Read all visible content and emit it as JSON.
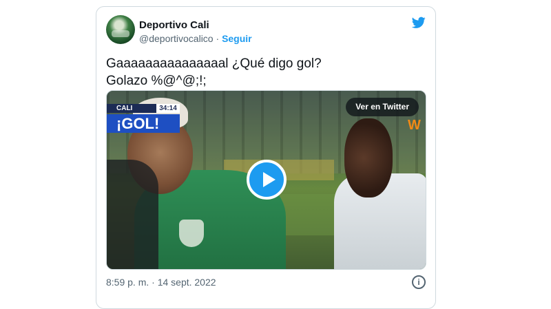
{
  "tweet": {
    "author_name": "Deportivo Cali",
    "handle": "@deportivocalico",
    "separator": " · ",
    "follow_label": "Seguir",
    "text": "Gaaaaaaaaaaaaaaal ¿Qué digo gol?\nGolazo %@^@;!;",
    "timestamp": "8:59 p. m. · 14 sept. 2022",
    "info_glyph": "i"
  },
  "media": {
    "scoreboard": {
      "team": "CALI",
      "time": "34:14",
      "banner": "¡GOL!"
    },
    "cta_label": "Ver en Twitter",
    "channel_logo": "W"
  },
  "colors": {
    "twitter_blue": "#1d9bf0",
    "text_primary": "#0f1419",
    "text_secondary": "#536471",
    "scoreboard_navy": "#1c2b55",
    "gol_blue": "#1e4fc2"
  },
  "icons": [
    "twitter-bird-icon",
    "play-icon",
    "info-icon"
  ]
}
